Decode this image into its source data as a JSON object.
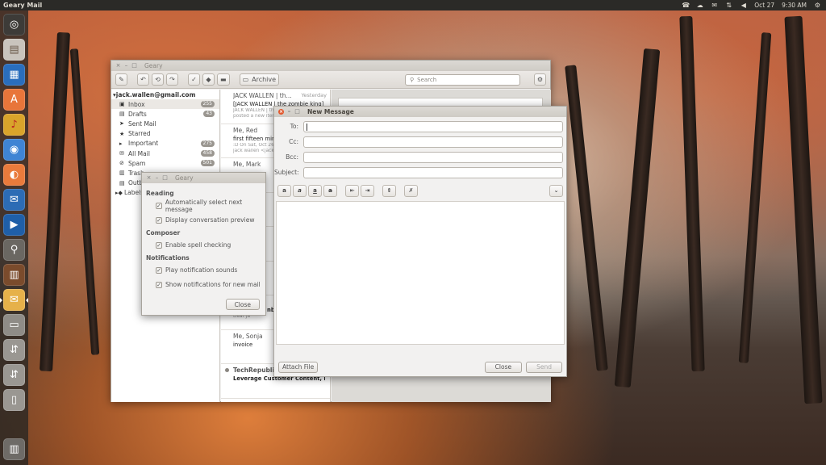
{
  "panel": {
    "app_title": "Geary Mail",
    "date": "Oct 27",
    "time": "9:30 AM"
  },
  "launcher": {
    "items": [
      "ubuntu-dash-icon",
      "files-icon",
      "writer-icon",
      "software-center-icon",
      "audio-icon",
      "chromium-icon",
      "impress-icon",
      "thunderbird-icon",
      "media-player-icon",
      "search-tool-icon",
      "books-icon",
      "geary-mail-icon",
      "drive-icon",
      "usb-drive-icon",
      "usb-drive-icon",
      "usb-stick-icon",
      "trash-icon"
    ]
  },
  "geary": {
    "title": "Geary",
    "archive_label": "Archive",
    "search_placeholder": "Search",
    "account": "jack.wallen@gmail.com",
    "folders": [
      {
        "name": "Inbox",
        "icon": "inbox-icon",
        "count": "255",
        "selected": true
      },
      {
        "name": "Drafts",
        "icon": "drafts-icon",
        "count": "43"
      },
      {
        "name": "Sent Mail",
        "icon": "sent-icon",
        "count": ""
      },
      {
        "name": "Starred",
        "icon": "star-icon",
        "count": ""
      },
      {
        "name": "Important",
        "icon": "important-icon",
        "count": "275"
      },
      {
        "name": "All Mail",
        "icon": "all-mail-icon",
        "count": "458"
      },
      {
        "name": "Spam",
        "icon": "spam-icon",
        "count": "501"
      },
      {
        "name": "Trash",
        "icon": "trash-icon",
        "count": ""
      },
      {
        "name": "Outbox",
        "icon": "outbox-icon",
        "count": ""
      },
      {
        "name": "Labels",
        "icon": "labels-icon",
        "count": ""
      }
    ],
    "conversations": [
      {
        "from": "JACK WALLEN | th...",
        "date": "Yesterday",
        "subject": "[JACK WALLEN | the zombie king] Let'",
        "preview": "JACK WALLEN | the zombie king",
        "preview2": "posted a new item"
      },
      {
        "from": "Me, Red",
        "date": "",
        "subject": "first fifteen minu",
        "preview": ":D On Sat, Oct 26, 2",
        "preview2": "jack wallen <jack.w"
      },
      {
        "from": "Me, Mark",
        "date": "",
        "subject": "",
        "preview": "",
        "preview2": ""
      },
      {
        "from": "",
        "date": "",
        "subject": "die",
        "preview": "",
        "preview2": ""
      },
      {
        "from": "",
        "date": "",
        "subject": "log",
        "preview": "",
        "preview2": ""
      },
      {
        "from": "",
        "date": "",
        "subject": "",
        "preview": "",
        "preview2": ""
      },
      {
        "from": "W",
        "date": "",
        "subject": "nb",
        "preview": "Dear Ja",
        "preview2": ""
      },
      {
        "from": "Me, Sonja",
        "date": "",
        "subject": "invoice",
        "preview": "",
        "preview2": ""
      },
      {
        "from": "TechRepublic",
        "date": "",
        "subject": "Leverage Customer Content, Enhanc...",
        "preview": "",
        "preview2": ""
      }
    ]
  },
  "prefs": {
    "title": "Geary",
    "sections": [
      {
        "heading": "Reading",
        "options": [
          "Automatically select next message",
          "Display conversation preview"
        ]
      },
      {
        "heading": "Composer",
        "options": [
          "Enable spell checking"
        ]
      },
      {
        "heading": "Notifications",
        "options": [
          "Play notification sounds",
          "Show notifications for new mail"
        ]
      }
    ],
    "close_label": "Close"
  },
  "compose": {
    "title": "New Message",
    "to_label": "To:",
    "cc_label": "Cc:",
    "bcc_label": "Bcc:",
    "subject_label": "Subject:",
    "attach_label": "Attach File",
    "close_label": "Close",
    "send_label": "Send"
  }
}
